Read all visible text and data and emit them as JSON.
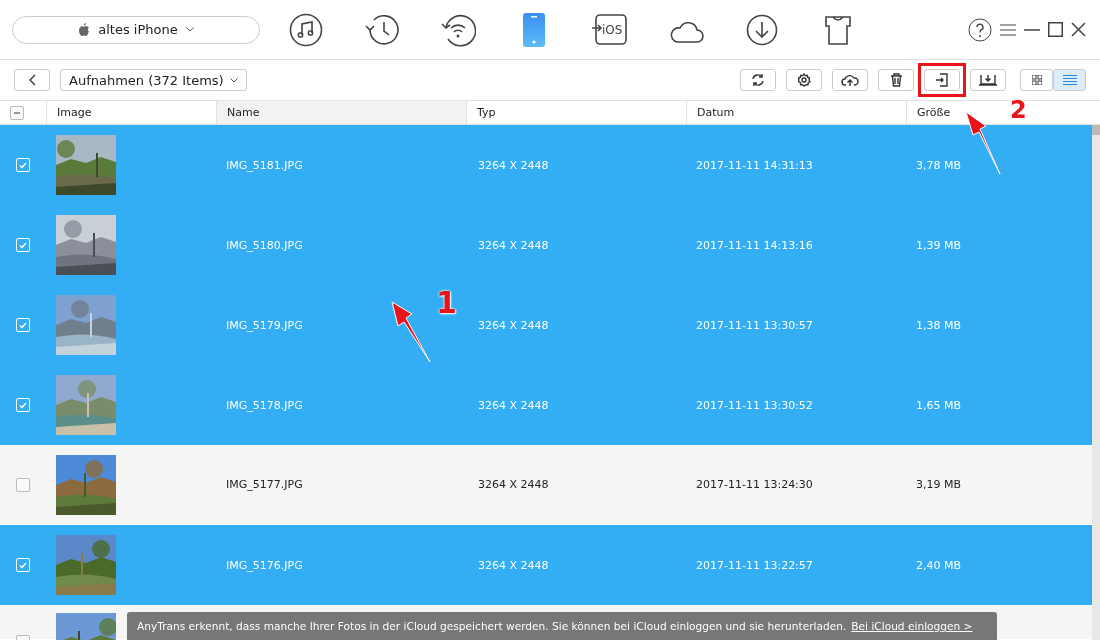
{
  "device": {
    "name": "altes iPhone"
  },
  "nav": [
    {
      "kind": "music",
      "selected": false
    },
    {
      "kind": "history",
      "selected": false
    },
    {
      "kind": "wifi",
      "selected": false
    },
    {
      "kind": "phone",
      "selected": true
    },
    {
      "kind": "ios",
      "label": "iOS",
      "selected": false
    },
    {
      "kind": "cloud",
      "selected": false
    },
    {
      "kind": "download",
      "selected": false
    },
    {
      "kind": "shirt",
      "selected": false
    }
  ],
  "album": {
    "label": "Aufnahmen (372 Items)"
  },
  "tools": [
    {
      "kind": "refresh",
      "highlighted": false
    },
    {
      "kind": "settings",
      "highlighted": false
    },
    {
      "kind": "upload",
      "highlighted": false
    },
    {
      "kind": "delete",
      "highlighted": false
    },
    {
      "kind": "export",
      "highlighted": true
    },
    {
      "kind": "to-computer",
      "highlighted": false
    }
  ],
  "views": [
    {
      "kind": "grid",
      "selected": false
    },
    {
      "kind": "list",
      "selected": true
    }
  ],
  "table": {
    "select_all": {
      "partial": true
    },
    "columns": [
      "Image",
      "Name",
      "Typ",
      "Datum",
      "Größe"
    ],
    "rows": [
      {
        "selected": true,
        "name": "IMG_5181.JPG",
        "type": "3264 X 2448",
        "date": "2017-11-11 14:31:13",
        "size": "3,78 MB"
      },
      {
        "selected": true,
        "name": "IMG_5180.JPG",
        "type": "3264 X 2448",
        "date": "2017-11-11 14:13:16",
        "size": "1,39 MB"
      },
      {
        "selected": true,
        "name": "IMG_5179.JPG",
        "type": "3264 X 2448",
        "date": "2017-11-11 13:30:57",
        "size": "1,38 MB"
      },
      {
        "selected": true,
        "name": "IMG_5178.JPG",
        "type": "3264 X 2448",
        "date": "2017-11-11 13:30:52",
        "size": "1,65 MB"
      },
      {
        "selected": false,
        "name": "IMG_5177.JPG",
        "type": "3264 X 2448",
        "date": "2017-11-11 13:24:30",
        "size": "3,19 MB"
      },
      {
        "selected": true,
        "name": "IMG_5176.JPG",
        "type": "3264 X 2448",
        "date": "2017-11-11 13:22:57",
        "size": "2,40 MB"
      }
    ],
    "partial_row": {
      "selected": false
    }
  },
  "notice": {
    "text": "AnyTrans erkennt, dass manche Ihrer Fotos in der iCloud gespeichert werden. Sie können bei iCloud einloggen und sie herunterladen.",
    "link": "Bei iCloud einloggen >"
  },
  "annotations": [
    {
      "label": "1"
    },
    {
      "label": "2"
    }
  ]
}
